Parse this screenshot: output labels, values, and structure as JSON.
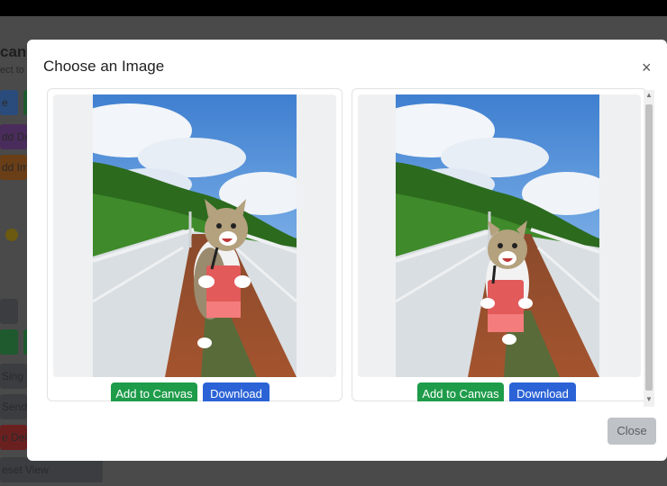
{
  "background": {
    "title_fragment": "canv",
    "subtitle_fragment": "ect to",
    "buttons": [
      {
        "label": "e",
        "color": "#2a4c7c"
      },
      {
        "label": "dd De",
        "color": "#4a2c5c"
      },
      {
        "label": "dd Ima",
        "color": "#6a3e16"
      },
      {
        "label": "Sing t",
        "color": "#3b3d40"
      },
      {
        "label": "Send a",
        "color": "#3b3d40"
      },
      {
        "label": "e Dele",
        "color": "#6b2020"
      },
      {
        "label": "eset View",
        "color": "#3b3d40"
      }
    ]
  },
  "modal": {
    "title": "Choose an Image",
    "close_icon": "×",
    "cards": [
      {
        "image": "cat-on-bridge-photo",
        "add_label": "Add to Canvas",
        "download_label": "Download"
      },
      {
        "image": "cat-on-bridge-photo",
        "add_label": "Add to Canvas",
        "download_label": "Download"
      }
    ],
    "scroll_up": "▲",
    "scroll_down": "▼",
    "close_label": "Close"
  },
  "colors": {
    "add_button": "#1e9c4a",
    "download_button": "#2b63d6",
    "close_button": "#bfc3c8"
  }
}
